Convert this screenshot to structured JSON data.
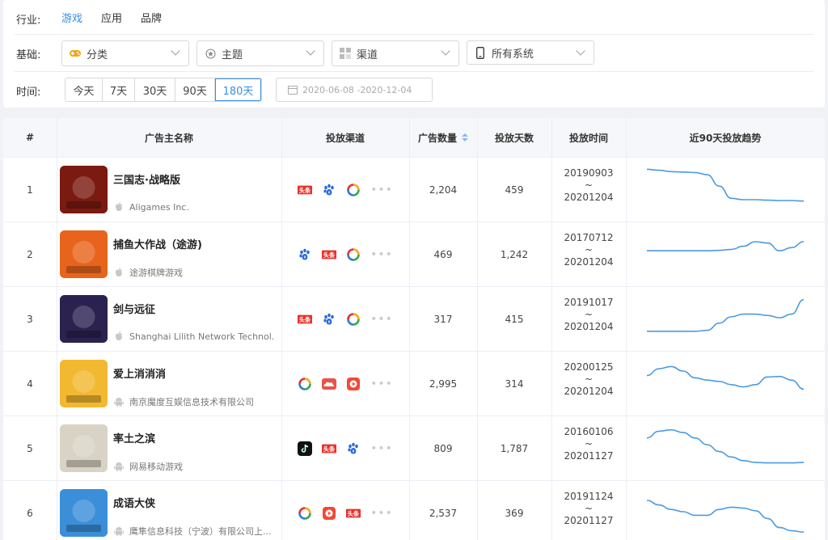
{
  "filters": {
    "industry": {
      "label": "行业:",
      "options": [
        "游戏",
        "应用",
        "品牌"
      ],
      "active": 0
    },
    "basis": {
      "label": "基础:",
      "selects": [
        {
          "label": "分类",
          "icon": "gamepad-icon"
        },
        {
          "label": "主题",
          "icon": "theme-icon"
        },
        {
          "label": "渠道",
          "icon": "grid-icon"
        },
        {
          "label": "所有系统",
          "icon": "phone-icon"
        }
      ]
    },
    "time": {
      "label": "时间:",
      "options": [
        "今天",
        "7天",
        "30天",
        "90天",
        "180天"
      ],
      "active": 4,
      "range_start": "2020-06-08",
      "range_end": "2020-12-04"
    }
  },
  "table": {
    "headers": [
      "#",
      "广告主名称",
      "投放渠道",
      "广告数量",
      "投放天数",
      "投放时间",
      "近90天投放趋势"
    ],
    "sort_column": "广告数量",
    "rows": [
      {
        "rank": "1",
        "name": "三国志·战略版",
        "company": "Aligames Inc.",
        "platform": "apple",
        "channels": [
          "toutiao",
          "baidu",
          "tencent"
        ],
        "ads": "2,204",
        "days": "459",
        "start": "20190903",
        "end": "20201204",
        "trend": [
          0.92,
          0.9,
          0.87,
          0.86,
          0.85,
          0.8,
          0.55,
          0.28,
          0.25,
          0.25,
          0.24,
          0.23,
          0.23,
          0.22
        ],
        "icon_color": "#7a1a10"
      },
      {
        "rank": "2",
        "name": "捕鱼大作战（途游)",
        "company": "途游棋牌游戏",
        "platform": "apple",
        "channels": [
          "baidu",
          "toutiao",
          "tencent"
        ],
        "ads": "469",
        "days": "1,242",
        "start": "20170712",
        "end": "20201204",
        "trend": [
          0.55,
          0.55,
          0.55,
          0.55,
          0.55,
          0.55,
          0.56,
          0.58,
          0.65,
          0.75,
          0.72,
          0.55,
          0.62,
          0.75
        ],
        "icon_color": "#e8641c"
      },
      {
        "rank": "3",
        "name": "剑与远征",
        "company": "Shanghai Lilith Network Technol...",
        "platform": "apple",
        "channels": [
          "toutiao",
          "baidu",
          "tencent"
        ],
        "ads": "317",
        "days": "415",
        "start": "20191017",
        "end": "20201204",
        "trend": [
          0.2,
          0.2,
          0.2,
          0.2,
          0.2,
          0.22,
          0.38,
          0.52,
          0.58,
          0.58,
          0.55,
          0.5,
          0.58,
          0.9
        ],
        "icon_color": "#2b2250"
      },
      {
        "rank": "4",
        "name": "爱上消消消",
        "company": "南京魔度互娱信息技术有限公司",
        "platform": "android",
        "channels": [
          "tencent",
          "cloud",
          "video"
        ],
        "ads": "2,995",
        "days": "314",
        "start": "20200125",
        "end": "20201204",
        "trend": [
          0.65,
          0.8,
          0.85,
          0.75,
          0.6,
          0.55,
          0.52,
          0.45,
          0.4,
          0.45,
          0.62,
          0.63,
          0.55,
          0.35
        ],
        "icon_color": "#f2b830"
      },
      {
        "rank": "5",
        "name": "率土之滨",
        "company": "网易移动游戏",
        "platform": "android",
        "channels": [
          "tiktok",
          "toutiao",
          "baidu"
        ],
        "ads": "809",
        "days": "1,787",
        "start": "20160106",
        "end": "20201127",
        "trend": [
          0.7,
          0.85,
          0.88,
          0.82,
          0.7,
          0.55,
          0.4,
          0.28,
          0.2,
          0.16,
          0.15,
          0.15,
          0.15,
          0.16
        ],
        "icon_color": "#d9d3c5"
      },
      {
        "rank": "6",
        "name": "成语大侠",
        "company": "鹰隼信息科技（宁波）有限公司上...",
        "platform": "android",
        "channels": [
          "tencent",
          "video",
          "toutiao"
        ],
        "ads": "2,537",
        "days": "369",
        "start": "20191124",
        "end": "20201127",
        "trend": [
          0.75,
          0.65,
          0.55,
          0.5,
          0.42,
          0.42,
          0.55,
          0.6,
          0.58,
          0.52,
          0.35,
          0.15,
          0.08,
          0.05
        ],
        "icon_color": "#3b8fd9"
      }
    ]
  },
  "colors": {
    "accent": "#3a8ee6",
    "trend_line": "#4a9be0"
  }
}
